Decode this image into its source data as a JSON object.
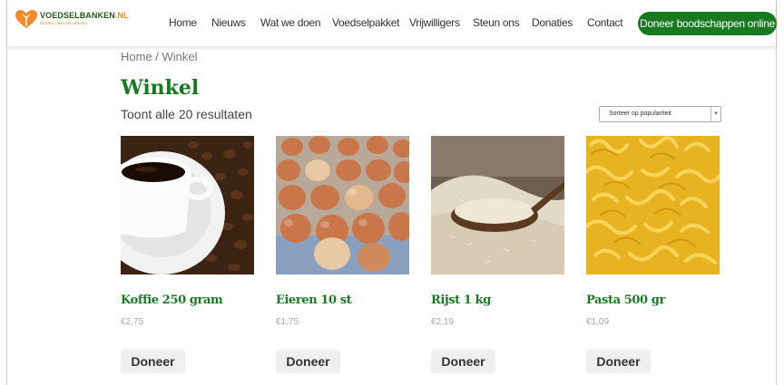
{
  "brand": {
    "name": "VOEDSELBANKEN",
    "tld": ".NL",
    "tagline": "Dichtbij - laat niet verloren",
    "colors": {
      "primary": "#177a21",
      "accent": "#f08c2a"
    }
  },
  "nav": {
    "items": [
      "Home",
      "Nieuws",
      "Wat we doen",
      "Voedselpakket",
      "Vrijwilligers",
      "Steun ons",
      "Donaties",
      "Contact"
    ],
    "cta_label": "Doneer boodschappen online"
  },
  "breadcrumb": "Home / Winkel",
  "page": {
    "title": "Winkel",
    "result_count": "Toont alle 20 resultaten",
    "sort_selected": "Sorteer op populariteit"
  },
  "products": [
    {
      "name": "Koffie 250 gram",
      "price": "€2,75",
      "button": "Doneer",
      "image": "coffee-cup"
    },
    {
      "name": "Eieren 10 st",
      "price": "€1,75",
      "button": "Doneer",
      "image": "eggs-tray"
    },
    {
      "name": "Rijst 1 kg",
      "price": "€2,19",
      "button": "Doneer",
      "image": "rice-spoon"
    },
    {
      "name": "Pasta 500 gr",
      "price": "€1,09",
      "button": "Doneer",
      "image": "fusilli-pasta"
    }
  ]
}
